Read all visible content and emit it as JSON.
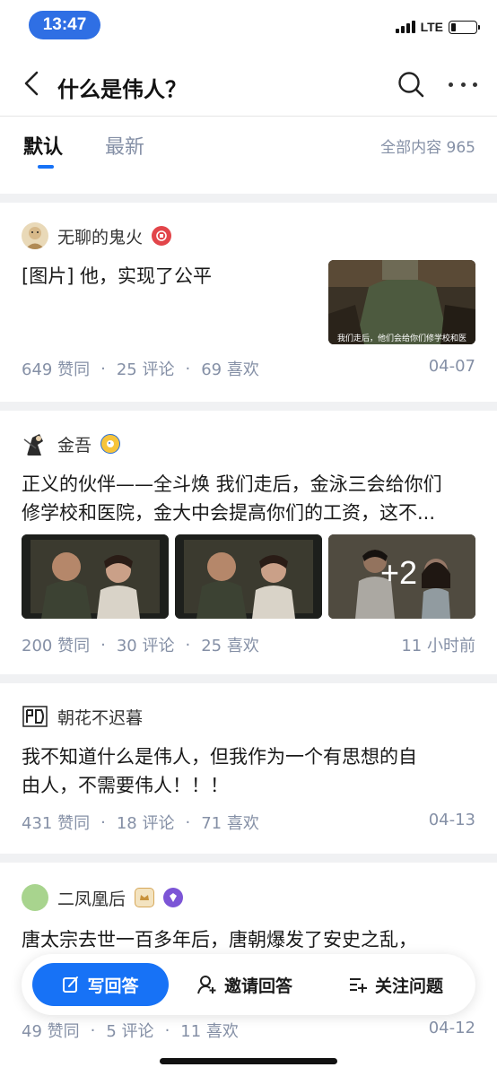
{
  "status_bar": {
    "time": "13:47",
    "network": "LTE",
    "battery_level": 0.2
  },
  "nav": {
    "title": "什么是伟人？"
  },
  "tabs": {
    "default_label": "默认",
    "new_label": "最新",
    "total_label": "全部内容 965"
  },
  "answers": [
    {
      "author": "无聊的鬼火",
      "content": "[图片] 他，实现了公平",
      "image_caption": "我们走后，他们会给你们修学校和医",
      "upvotes": "649 赞同",
      "comments": "25 评论",
      "likes": "69 喜欢",
      "date": "04-07"
    },
    {
      "author": "金吾",
      "content_line1": "正义的伙伴——全斗焕 我们走后，金泳三会给你们",
      "content_line2": "修学校和医院，金大中会提高你们的工资，这不...",
      "image_overlay": "+2",
      "upvotes": "200 赞同",
      "comments": "30 评论",
      "likes": "25 喜欢",
      "date": "11 小时前"
    },
    {
      "author": "朝花不迟暮",
      "content_line1": "我不知道什么是伟人，但我作为一个有思想的自",
      "content_line2": "由人，不需要伟人！！！",
      "upvotes": "431 赞同",
      "comments": "18 评论",
      "likes": "71 喜欢",
      "date": "04-13"
    },
    {
      "author": "二凤凰后",
      "content": "唐太宗去世一百多年后，唐朝爆发了安史之乱，",
      "upvotes": "49 赞同",
      "comments": "5 评论",
      "likes": "11 喜欢",
      "date": "04-12"
    }
  ],
  "separator": "·",
  "bottom_bar": {
    "write_label": "写回答",
    "invite_label": "邀请回答",
    "follow_label": "关注问题"
  },
  "colors": {
    "accent": "#1772f6",
    "muted": "#8590a6",
    "time_pill": "#2f6fe4"
  },
  "icons": [
    "back-arrow-icon",
    "search-icon",
    "more-icon",
    "edit-icon",
    "invite-user-icon",
    "follow-list-icon"
  ]
}
